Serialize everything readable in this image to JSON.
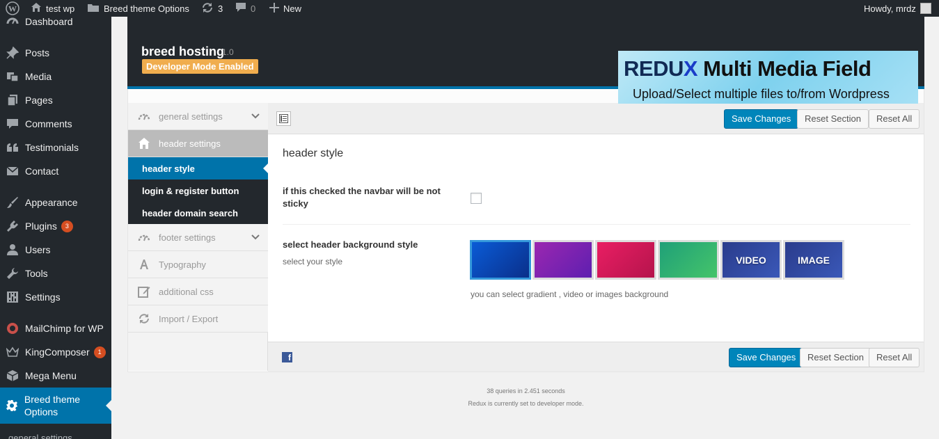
{
  "adminbar": {
    "site_name": "test wp",
    "theme_options": "Breed theme Options",
    "updates": "3",
    "comments": "0",
    "new_label": "New",
    "greeting": "Howdy, mrdz"
  },
  "sidebar": {
    "items": [
      {
        "label": "Dashboard",
        "icon": "dashboard-icon"
      },
      {
        "label": "Posts",
        "icon": "pin-icon"
      },
      {
        "label": "Media",
        "icon": "media-icon"
      },
      {
        "label": "Pages",
        "icon": "pages-icon"
      },
      {
        "label": "Comments",
        "icon": "comment-icon"
      },
      {
        "label": "Testimonials",
        "icon": "quote-icon"
      },
      {
        "label": "Contact",
        "icon": "mail-icon"
      },
      {
        "label": "Appearance",
        "icon": "brush-icon"
      },
      {
        "label": "Plugins",
        "icon": "plug-icon",
        "badge": "3"
      },
      {
        "label": "Users",
        "icon": "user-icon"
      },
      {
        "label": "Tools",
        "icon": "wrench-icon"
      },
      {
        "label": "Settings",
        "icon": "sliders-icon"
      },
      {
        "label": "MailChimp for WP",
        "icon": "mailchimp-icon"
      },
      {
        "label": "KingComposer",
        "icon": "crown-icon",
        "badge": "1"
      },
      {
        "label": "Mega Menu",
        "icon": "cube-icon"
      },
      {
        "label": "Breed theme Options",
        "icon": "gear-icon"
      }
    ],
    "submenu_first": "general settings"
  },
  "header": {
    "title": "breed hosting",
    "version": "1.0",
    "dev_mode": "Developer Mode Enabled"
  },
  "banner": {
    "brand_part1": "REDU",
    "brand_part2": "X",
    "title": "Multi Media Field",
    "subtitle": "Upload/Select multiple files to/from Wordpress"
  },
  "nav": {
    "general": "general settings",
    "header": "header settings",
    "sub_style": "header style",
    "sub_login": "login & register button",
    "sub_domain": "header domain search",
    "footer": "footer settings",
    "typography": "Typography",
    "css": "additional css",
    "import": "Import / Export"
  },
  "actions": {
    "save": "Save Changes",
    "reset_section": "Reset Section",
    "reset_all": "Reset All"
  },
  "section": {
    "title": "header style",
    "sticky_label": "if this checked the navbar will be not sticky",
    "sticky_checked": false,
    "bg_label": "select header background style",
    "bg_sub": "select your style",
    "bg_options": [
      {
        "label": "",
        "gradient": "linear-gradient(135deg,#0a5bd6,#0a2f8a)",
        "selected": true
      },
      {
        "label": "",
        "gradient": "linear-gradient(135deg,#9b27b0,#5e1fb0)",
        "selected": false
      },
      {
        "label": "",
        "gradient": "linear-gradient(135deg,#e91e63,#b5144c)",
        "selected": false
      },
      {
        "label": "",
        "gradient": "linear-gradient(135deg,#1fa078,#45c46a)",
        "selected": false
      },
      {
        "label": "VIDEO",
        "gradient": "linear-gradient(135deg,#2a3c8c,#3a58b8)",
        "selected": false
      },
      {
        "label": "IMAGE",
        "gradient": "linear-gradient(135deg,#2a3c8c,#3a58b8)",
        "selected": false
      }
    ],
    "bg_desc": "you can select gradient , video or images background"
  },
  "footer": {
    "queries": "38 queries in 2.451 seconds",
    "devmode": "Redux is currently set to developer mode."
  },
  "colors": {
    "admin_dark": "#23282d",
    "wp_blue": "#0073aa",
    "badge": "#d54e21",
    "dev_badge": "#f0ad4e"
  }
}
